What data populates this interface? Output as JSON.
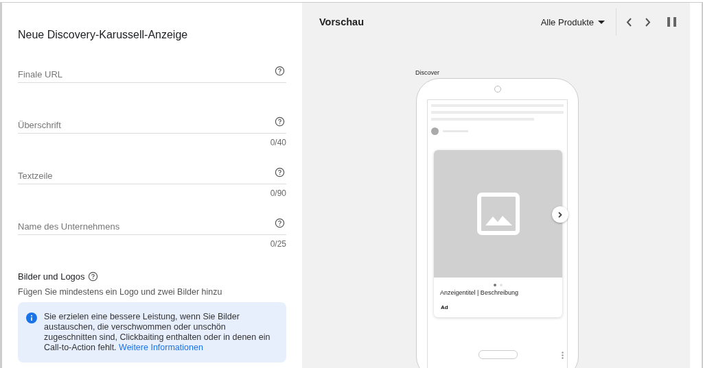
{
  "form": {
    "title": "Neue Discovery-Karussell-Anzeige",
    "fields": [
      {
        "placeholder": "Finale URL"
      },
      {
        "placeholder": "Überschrift",
        "counter": "0/40"
      },
      {
        "placeholder": "Textzeile",
        "counter": "0/90"
      },
      {
        "placeholder": "Name des Unternehmens",
        "counter": "0/25"
      }
    ],
    "images_section": {
      "title": "Bilder und Logos",
      "hint": "Fügen Sie mindestens ein Logo und zwei Bilder hinzu"
    },
    "info_box": {
      "text": "Sie erzielen eine bessere Leistung, wenn Sie Bilder austauschen, die verschwommen oder unschön zugeschnitten sind, Clickbaiting enthalten oder in denen ein Call-to-Action fehlt.",
      "link": "Weitere Informationen"
    }
  },
  "preview": {
    "title": "Vorschau",
    "product_dropdown": "Alle Produkte",
    "surface_label": "Discover",
    "ad_card": {
      "headline": "Anzeigentitel | Beschreibung",
      "badge": "Ad",
      "dots": [
        {
          "selected": true
        },
        {
          "selected": false
        }
      ]
    }
  }
}
